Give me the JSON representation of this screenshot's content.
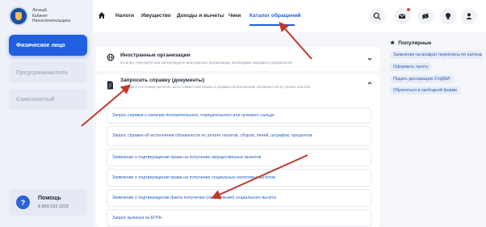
{
  "brand": {
    "line1": "Личный",
    "line2": "Кабинет",
    "line3": "Налогоплательщика"
  },
  "sidebar": {
    "items": [
      {
        "label": "Физическое лицо"
      },
      {
        "label": "Предприниматель"
      },
      {
        "label": "Самозанятый"
      }
    ],
    "help": {
      "title": "Помощь",
      "phone": "8 800 222 2222",
      "icon_glyph": "?"
    }
  },
  "nav": {
    "items": [
      {
        "label": "Налоги"
      },
      {
        "label": "Имущество"
      },
      {
        "label": "Доходы и вычеты"
      },
      {
        "label": "Чеки"
      },
      {
        "label": "Каталог обращений"
      }
    ],
    "active_index": 4
  },
  "header_icons": [
    "search-icon",
    "mail-icon",
    "eye-off-icon",
    "bulb-icon",
    "user-icon"
  ],
  "sections": {
    "foreign": {
      "title": "Иностранные организации",
      "subtitle": "Если Вы участвуете или контролируете иностранные организации, необходимо направить уведомление"
    },
    "request": {
      "title": "Запросить справку (документы)",
      "subtitle": "Справки о состоянии расчетов, акты совместной сверки и справки об исполнении обязанностей по уплате налогов",
      "links": [
        {
          "label": "Запрос справки о наличии положительного, отрицательного или нулевого сальдо"
        },
        {
          "label": "Запрос справки об исполнении обязанности по уплате налогов, сборов, пеней, штрафов, процентов"
        },
        {
          "label": "Заявление о подтверждении права на получение имущественных вычетов"
        },
        {
          "label": "Заявление о подтверждении права на получение социальных налоговых вычетов"
        },
        {
          "label": "Заявление о подтверждении факта получения (неполучения) социального вычета"
        },
        {
          "label": "Запрос выписки из ЕГРН"
        }
      ]
    }
  },
  "popular": {
    "title": "Популярные",
    "star": "★",
    "links": [
      {
        "label": "Заявление на возврат переплаты по налогам"
      },
      {
        "label": "Оформить льготу"
      },
      {
        "label": "Подать декларацию 3-НДФЛ"
      },
      {
        "label": "Обратиться в свободной форме"
      }
    ]
  },
  "colors": {
    "accent": "#1f5fe0",
    "link": "#2a5bb8",
    "arrow": "#c0392b"
  }
}
